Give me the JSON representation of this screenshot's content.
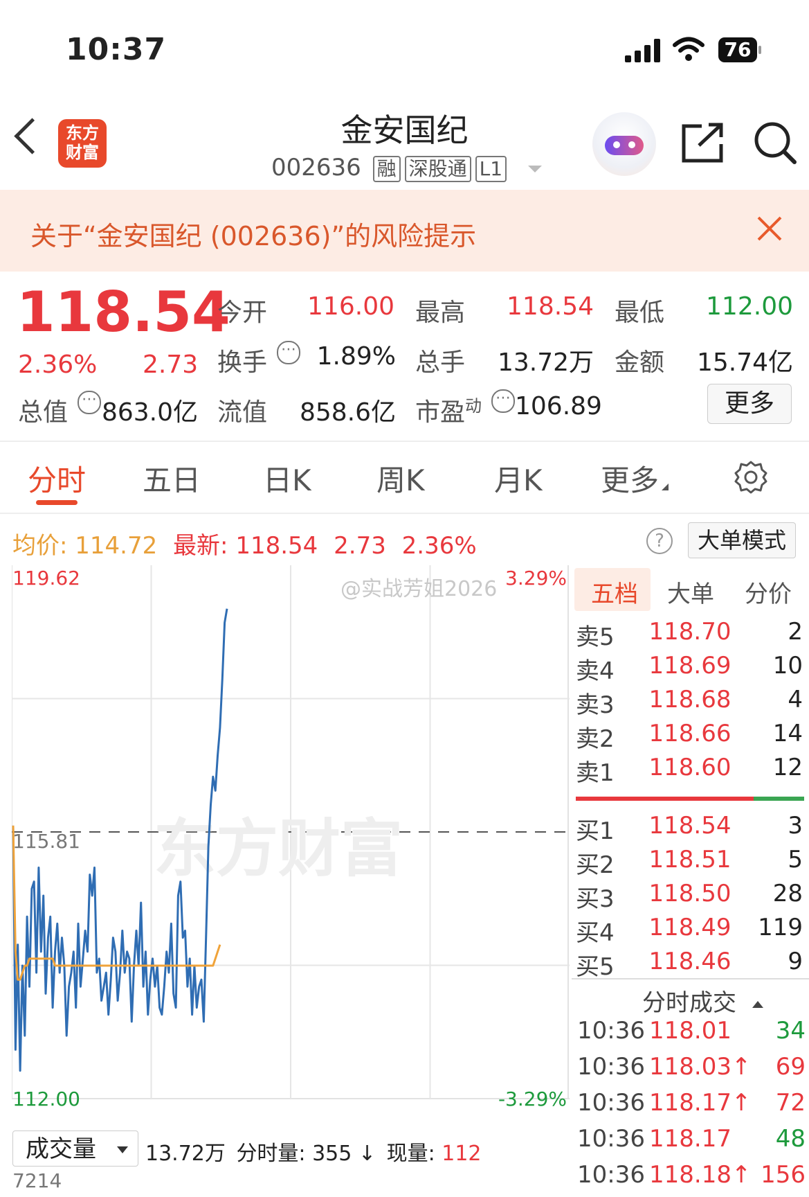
{
  "status_bar": {
    "time": "10:37",
    "battery": "76"
  },
  "header": {
    "logo_text": "东方财富",
    "title": "金安国纪",
    "code": "002636",
    "tags": [
      "融",
      "深股通",
      "L1"
    ]
  },
  "risk_banner": {
    "text": "关于“金安国纪 (002636)”的风险提示"
  },
  "quote": {
    "price": "118.54",
    "change_pct": "2.36%",
    "change": "2.73",
    "open_label": "今开",
    "open": "116.00",
    "high_label": "最高",
    "high": "118.54",
    "low_label": "最低",
    "low": "112.00",
    "turnover_label": "换手",
    "turnover": "1.89%",
    "volume_label": "总手",
    "volume": "13.72万",
    "amount_label": "金额",
    "amount": "15.74亿",
    "mktcap_label": "总值",
    "mktcap": "863.0亿",
    "float_label": "流值",
    "float_cap": "858.6亿",
    "pe_label": "市盈",
    "pe_sup": "动",
    "pe": "106.89",
    "more_button": "更多"
  },
  "tabs": [
    "分时",
    "五日",
    "日K",
    "周K",
    "月K",
    "更多"
  ],
  "chart_header": {
    "avg_label": "均价:",
    "avg": "114.72",
    "latest_label": "最新:",
    "latest": "118.54",
    "latest_change": "2.73",
    "latest_pct": "2.36%",
    "big_order_button": "大单模式"
  },
  "chart_data": {
    "type": "line",
    "ylim": [
      112.0,
      119.62
    ],
    "y_top_label": "119.62",
    "y_bottom_label": "112.00",
    "y_mid_label": "115.81",
    "pct_top": "3.29%",
    "pct_bottom": "-3.29%",
    "watermark": "@实战芳姐2026",
    "brand_watermark": "东方财富",
    "series": [
      {
        "color": "#2f6db3",
        "values": [
          115.9,
          112.7,
          114.2,
          112.4,
          113.9,
          112.9,
          114.6,
          113.6,
          115.0,
          115.1,
          113.8,
          115.3,
          114.1,
          114.9,
          113.5,
          114.3,
          114.6,
          113.3,
          114.1,
          114.5,
          113.8,
          114.3,
          113.9,
          112.9,
          113.6,
          113.8,
          114.1,
          113.3,
          114.5,
          113.6,
          114.0,
          114.4,
          114.1,
          115.2,
          114.9,
          115.3,
          113.8,
          114.0,
          113.4,
          113.6,
          113.8,
          113.2,
          113.7,
          114.3,
          114.1,
          113.4,
          113.8,
          114.4,
          113.8,
          114.1,
          114.0,
          113.1,
          113.9,
          114.4,
          113.9,
          114.8,
          113.6,
          114.1,
          113.2,
          113.7,
          114.0,
          113.6,
          113.9,
          113.3,
          113.2,
          113.6,
          114.1,
          113.8,
          114.5,
          113.5,
          113.3,
          114.9,
          115.1,
          114.3,
          114.4,
          113.6,
          114.0,
          113.2,
          113.9,
          113.3,
          113.6,
          113.7,
          113.1,
          114.3,
          115.6,
          116.2,
          116.6,
          116.4,
          116.9,
          117.3,
          118.0,
          118.8,
          119.0
        ]
      },
      {
        "color": "#f0a33a",
        "values": [
          115.9,
          114.1,
          113.7,
          113.7,
          113.8,
          113.9,
          113.9,
          114.0,
          114.0,
          114.0,
          114.0,
          114.0,
          114.0,
          114.0,
          114.0,
          114.0,
          114.0,
          114.0,
          113.9,
          113.9,
          113.9,
          113.9,
          113.9,
          113.9,
          113.9,
          113.9,
          113.9,
          113.9,
          113.9,
          113.9,
          113.9,
          113.9,
          113.9,
          113.9,
          113.9,
          113.9,
          113.9,
          113.9,
          113.9,
          113.9,
          113.9,
          113.9,
          113.9,
          113.9,
          113.9,
          113.9,
          113.9,
          113.9,
          113.9,
          113.9,
          113.9,
          113.9,
          113.9,
          113.9,
          113.9,
          113.9,
          113.9,
          113.9,
          113.9,
          113.9,
          113.9,
          113.9,
          113.9,
          113.9,
          113.9,
          113.9,
          113.9,
          113.9,
          113.9,
          113.9,
          113.9,
          113.9,
          113.9,
          113.9,
          113.9,
          113.9,
          113.9,
          113.9,
          113.9,
          113.9,
          113.9,
          113.9,
          113.9,
          113.9,
          113.9,
          113.9,
          113.9,
          114.0,
          114.1,
          114.2
        ]
      }
    ]
  },
  "order_book": {
    "tabs": [
      "五档",
      "大单",
      "分价"
    ],
    "asks": [
      {
        "label": "卖5",
        "price": "118.70",
        "qty": "2"
      },
      {
        "label": "卖4",
        "price": "118.69",
        "qty": "10"
      },
      {
        "label": "卖3",
        "price": "118.68",
        "qty": "4"
      },
      {
        "label": "卖2",
        "price": "118.66",
        "qty": "14"
      },
      {
        "label": "卖1",
        "price": "118.60",
        "qty": "12"
      }
    ],
    "bids": [
      {
        "label": "买1",
        "price": "118.54",
        "qty": "3"
      },
      {
        "label": "买2",
        "price": "118.51",
        "qty": "5"
      },
      {
        "label": "买3",
        "price": "118.50",
        "qty": "28"
      },
      {
        "label": "买4",
        "price": "118.49",
        "qty": "119"
      },
      {
        "label": "买5",
        "price": "118.46",
        "qty": "9"
      }
    ],
    "buy_sell_ratio": 0.78
  },
  "trades": {
    "title": "分时成交",
    "rows": [
      {
        "time": "10:36",
        "price": "118.01",
        "vol": "34",
        "side": "sell"
      },
      {
        "time": "10:36",
        "price": "118.03↑",
        "vol": "69",
        "side": "buy"
      },
      {
        "time": "10:36",
        "price": "118.17↑",
        "vol": "72",
        "side": "buy"
      },
      {
        "time": "10:36",
        "price": "118.17",
        "vol": "48",
        "side": "sell"
      },
      {
        "time": "10:36",
        "price": "118.18↑",
        "vol": "156",
        "side": "buy"
      }
    ]
  },
  "volume_bar": {
    "selector": "成交量",
    "total": "13.72万",
    "minute_label": "分时量:",
    "minute": "355",
    "arrow": "↓",
    "current_label": "现量:",
    "current": "112",
    "partial_value": "7214"
  }
}
